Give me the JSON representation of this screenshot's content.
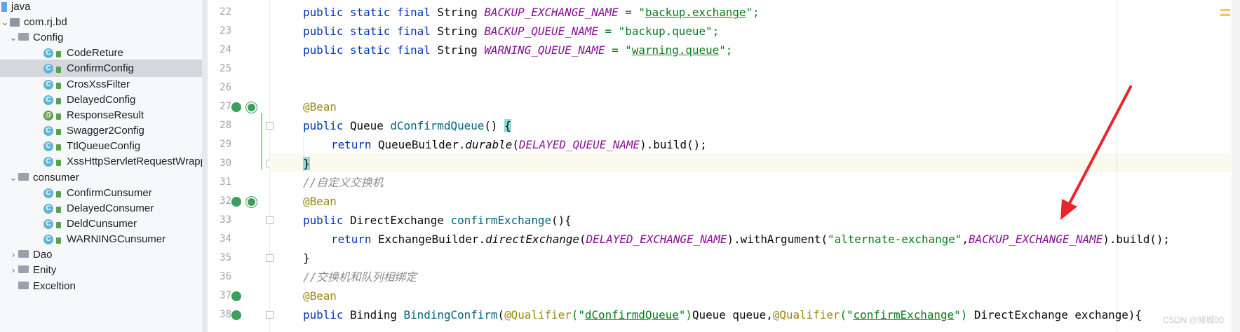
{
  "tree": {
    "root_label": "java",
    "package_label": "com.rj.bd",
    "config_label": "Config",
    "config_items": [
      "CodeReture",
      "ConfirmConfig",
      "CrosXssFilter",
      "DelayedConfig",
      "ResponseResult",
      "Swagger2Config",
      "TtlQueueConfig",
      "XssHttpServletRequestWrapp"
    ],
    "consumer_label": "consumer",
    "consumer_items": [
      "ConfirmCunsumer",
      "DelayedConsumer",
      "DeldCunsumer",
      "WARNINGCunsumer"
    ],
    "dao_label": "Dao",
    "enity_label": "Enity",
    "exception_label": "Exceltion",
    "class_glyph": "C",
    "anno_glyph": "@"
  },
  "gutter": {
    "line_numbers": [
      "22",
      "23",
      "24",
      "25",
      "26",
      "27",
      "28",
      "29",
      "30",
      "31",
      "32",
      "33",
      "34",
      "35",
      "36",
      "37",
      "38"
    ]
  },
  "code": {
    "l22": {
      "kw": "public static final",
      "type": "String",
      "const": "BACKUP_EXCHANGE_NAME",
      "eq": " = \"",
      "str": "backup.exchange",
      "end": "\";"
    },
    "l23": {
      "kw": "public static final",
      "type": "String",
      "const": "BACKUP_QUEUE_NAME",
      "str": " = \"backup.queue\";"
    },
    "l24": {
      "kw": "public static final",
      "type": "String",
      "const": "WARNING_QUEUE_NAME",
      "eq": " = \"",
      "str": "warning.queue",
      "end": "\";"
    },
    "l27": {
      "anno": "@Bean"
    },
    "l28": {
      "kw": "public",
      "type": "Queue",
      "method": "dConfirmdQueue",
      "rest": "() ",
      "brace": "{"
    },
    "l29": {
      "kw": "return",
      "pre": "QueueBuilder.",
      "call": "durable",
      "open": "(",
      "const": "DELAYED_QUEUE_NAME",
      "rest": ").build();"
    },
    "l30": {
      "brace": "}"
    },
    "l31": {
      "comment": "//自定义交换机"
    },
    "l32": {
      "anno": "@Bean"
    },
    "l33": {
      "kw": "public",
      "type": "DirectExchange",
      "method": "confirmExchange",
      "rest": "(){"
    },
    "l34": {
      "kw": "return",
      "pre": "ExchangeBuilder.",
      "call": "directExchange",
      "open": "(",
      "const1": "DELAYED_EXCHANGE_NAME",
      "mid": ").withArgument(",
      "str": "\"alternate-exchange\"",
      "comma": ",",
      "const2": "BACKUP_EXCHANGE_NAME",
      "rest": ").build();"
    },
    "l35": {
      "brace": "}"
    },
    "l36": {
      "comment": "//交换机和队列相绑定"
    },
    "l37": {
      "anno": "@Bean"
    },
    "l38": {
      "kw": "public",
      "type": "Binding",
      "method": "BindingConfirm",
      "p1": "(",
      "anno1": "@Qualifier",
      "s1a": "(\"",
      "s1": "dConfirmdQueue",
      "s1b": "\")",
      "mid": "Queue queue,",
      "anno2": "@Qualifier",
      "s2a": "(\"",
      "s2": "confirmExchange",
      "s2b": "\")",
      "rest": " DirectExchange exchange){"
    }
  },
  "annotation_arrow_color": "#e8252a",
  "watermark": "CSDN @倾城00"
}
